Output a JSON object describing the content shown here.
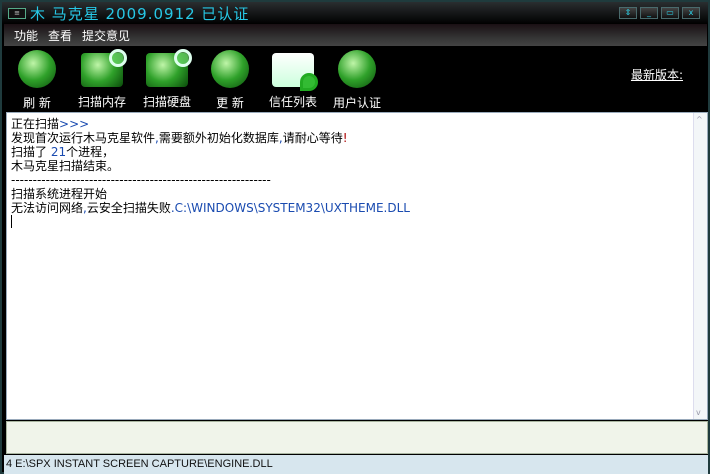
{
  "title": "木 马克星 2009.0912  已认证",
  "window_buttons": {
    "restore": "⇕",
    "minimize": "_",
    "maximize": "▭",
    "close": "x"
  },
  "menu": [
    "功能",
    "查看",
    "提交意见"
  ],
  "toolbar": [
    {
      "label": "刷 新",
      "icon": "radar-icon"
    },
    {
      "label": "扫描内存",
      "icon": "memory-scan-icon"
    },
    {
      "label": "扫描硬盘",
      "icon": "disk-scan-icon"
    },
    {
      "label": "更 新",
      "icon": "update-icon"
    },
    {
      "label": "信任列表",
      "icon": "trust-list-icon"
    },
    {
      "label": "用户认证",
      "icon": "user-auth-icon"
    }
  ],
  "latest_version_label": "最新版本:",
  "log": {
    "l1a": "正在扫描",
    "l1b": ">>>",
    "l2a": "发现首次运行木马克星软件",
    "l2b": ",",
    "l2c": "需要额外初始化数据库",
    "l2d": ",",
    "l2e": "请耐心等待",
    "l2f": "!",
    "l3a": "扫描了 ",
    "l3b": "21",
    "l3c": "个进程，",
    "l4": "木马克星扫描结束。",
    "l5": "------------------------------------------------------------",
    "l6": "扫描系统进程开始",
    "l7a": "无法访问网络",
    "l7b": ",",
    "l7c": "云安全扫描失败",
    "l7d": ".C:\\WINDOWS\\SYSTEM32\\UXTHEME.DLL"
  },
  "status": "4  E:\\SPX INSTANT SCREEN CAPTURE\\ENGINE.DLL"
}
